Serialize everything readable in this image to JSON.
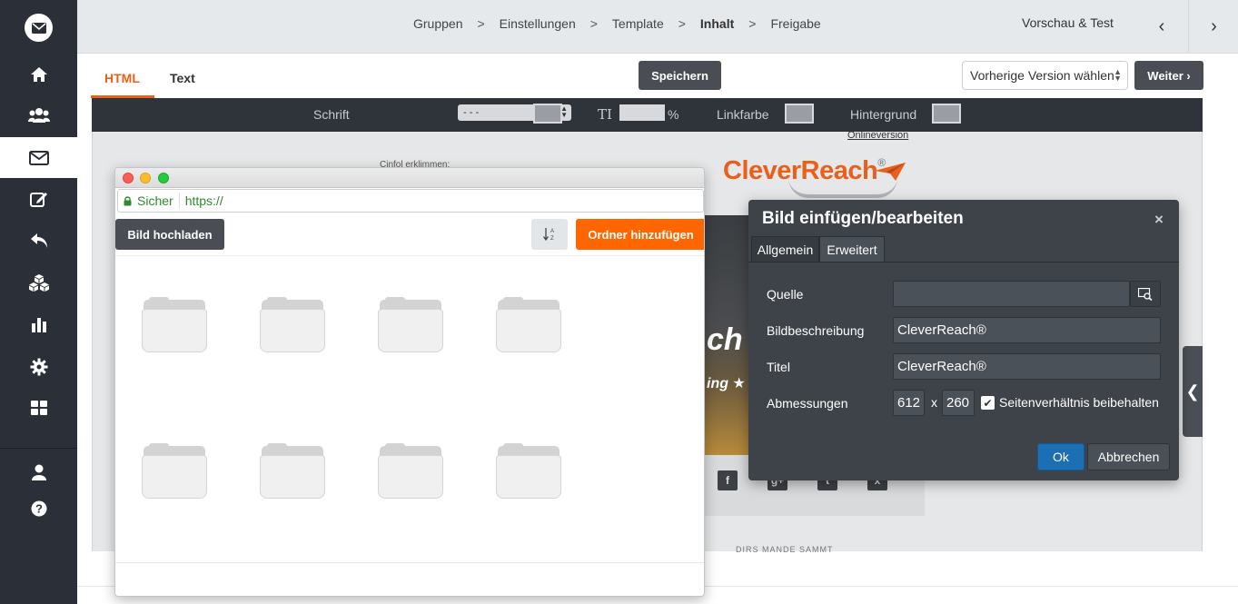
{
  "sidebar": {
    "logo_icon": "mail-icon",
    "items": [
      {
        "icon": "home-icon"
      },
      {
        "icon": "users-icon"
      },
      {
        "icon": "envelope-icon",
        "active": true
      },
      {
        "icon": "edit-icon"
      },
      {
        "icon": "reply-icon"
      },
      {
        "icon": "cubes-icon"
      },
      {
        "icon": "bar-chart-icon"
      },
      {
        "icon": "gear-icon"
      },
      {
        "icon": "grid-icon"
      },
      {
        "icon": "user-icon"
      },
      {
        "icon": "help-icon"
      }
    ]
  },
  "breadcrumb": {
    "steps": [
      "Gruppen",
      "Einstellungen",
      "Template",
      "Inhalt",
      "Freigabe"
    ],
    "current": "Inhalt",
    "separator": ">"
  },
  "topbar": {
    "preview_label": "Vorschau & Test",
    "prev_arrow": "‹",
    "next_arrow": "›"
  },
  "tabs": {
    "html_label": "HTML",
    "text_label": "Text",
    "active": "HTML"
  },
  "actions": {
    "save_label": "Speichern",
    "version_select": "Vorherige Version wählen",
    "next_label": "Weiter ›"
  },
  "editor_toolbar": {
    "font_label": "Schrift",
    "font_value": "- - -",
    "size_unit": "%",
    "linkcolor_label": "Linkfarbe",
    "background_label": "Hintergrund"
  },
  "canvas": {
    "online_version": "Onlineversion",
    "faint_text": "Cinfol erklimmen:",
    "logo_text": "CleverReach",
    "logo_reg": "®",
    "hero_text": "ch",
    "hero_sub": "ing ★",
    "social": [
      "f",
      "g+",
      "t",
      "x"
    ],
    "footer_faint": "DIRS MANDE SAMMT"
  },
  "file_browser": {
    "secure_label": "Sicher",
    "url": "https://",
    "upload_label": "Bild hochladen",
    "sort_icon": "sort-alpha-icon",
    "add_folder_label": "Ordner hinzufügen",
    "folder_count": 8
  },
  "image_dialog": {
    "title": "Bild einfügen/bearbeiten",
    "close": "×",
    "tabs": [
      "Allgemein",
      "Erweitert"
    ],
    "source_label": "Quelle",
    "source_value": "",
    "description_label": "Bildbeschreibung",
    "description_value": "CleverReach®",
    "title_label": "Titel",
    "title_value": "CleverReach®",
    "dimensions_label": "Abmessungen",
    "width": "612",
    "height": "260",
    "times": "x",
    "keep_ratio_label": "Seitenverhältnis beibehalten",
    "keep_ratio_checked": true,
    "ok_label": "Ok",
    "cancel_label": "Abbrechen"
  },
  "colors": {
    "accent": "#e8601c",
    "brand_orange": "#ff6600",
    "sidebar_bg": "#2b3038",
    "dialog_bg": "#3e434a",
    "ok_blue": "#1c6fb3"
  }
}
